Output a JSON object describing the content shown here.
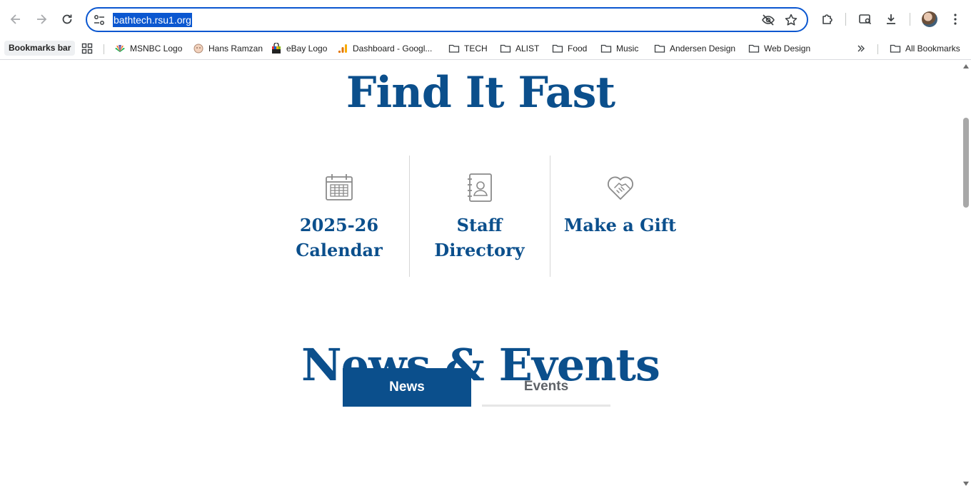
{
  "browser": {
    "url": "bathtech.rsu1.org",
    "bookmarks_bar_label": "Bookmarks bar",
    "bookmarks": [
      {
        "label": "MSNBC Logo"
      },
      {
        "label": "Hans Ramzan"
      },
      {
        "label": "eBay Logo"
      },
      {
        "label": "Dashboard - Googl..."
      },
      {
        "label": "TECH"
      },
      {
        "label": "ALIST"
      },
      {
        "label": "Food"
      },
      {
        "label": "Music"
      },
      {
        "label": "Andersen Design"
      },
      {
        "label": "Web Design"
      }
    ],
    "all_bookmarks_label": "All Bookmarks"
  },
  "page": {
    "find_heading": "Find It Fast",
    "quick_links": [
      {
        "line1": "2025-26",
        "line2": "Calendar",
        "icon": "calendar-icon"
      },
      {
        "line1": "Staff Directory",
        "line2": "",
        "icon": "contact-book-icon"
      },
      {
        "line1": "Make a Gift",
        "line2": "",
        "icon": "heart-handshake-icon"
      }
    ],
    "news_heading": "News & Events",
    "tabs": {
      "news": "News",
      "events": "Events"
    }
  },
  "colors": {
    "brand_blue": "#0b4f8c",
    "focus_blue": "#0b57d0"
  }
}
